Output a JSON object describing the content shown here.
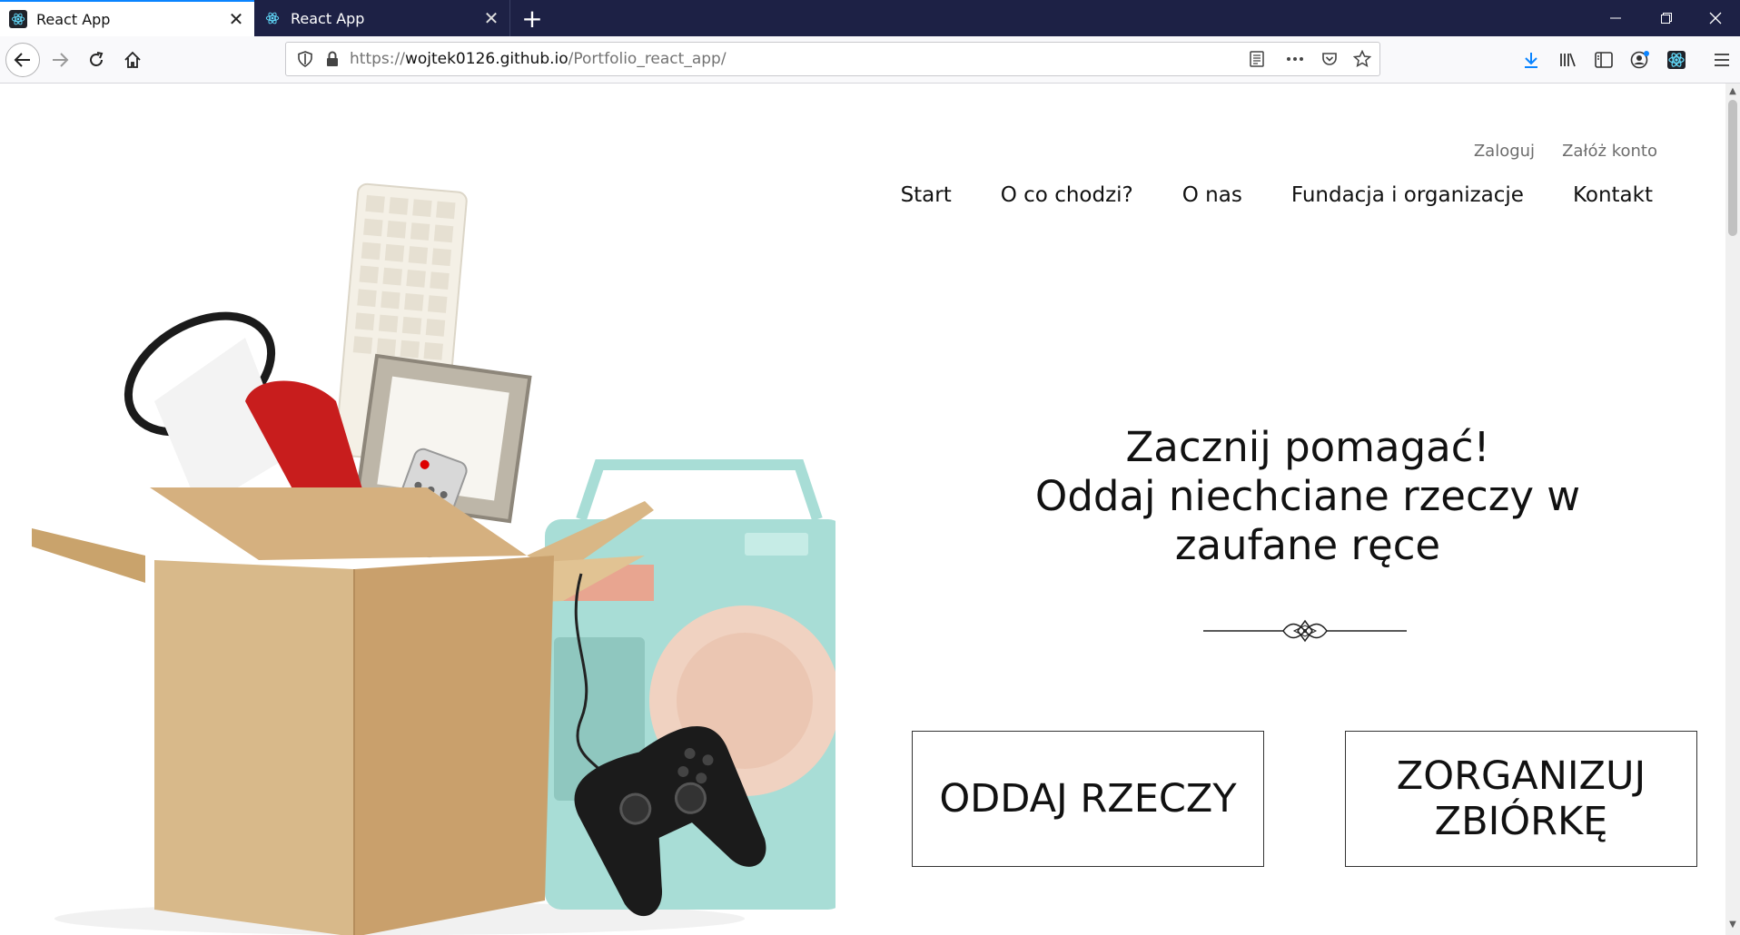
{
  "browser": {
    "tabs": [
      {
        "title": "React App",
        "active": true
      },
      {
        "title": "React App",
        "active": false
      }
    ],
    "url": {
      "scheme": "https://",
      "host": "wojtek0126.github.io",
      "path": "/Portfolio_react_app/"
    },
    "accent_color": "#0a84ff",
    "tabbar_color": "#1d2145"
  },
  "header": {
    "auth": {
      "login": "Zaloguj",
      "register": "Załóż konto"
    },
    "nav": [
      {
        "label": "Start"
      },
      {
        "label": "O co chodzi?"
      },
      {
        "label": "O nas"
      },
      {
        "label": "Fundacja i organizacje"
      },
      {
        "label": "Kontakt"
      }
    ]
  },
  "hero": {
    "headline_lines": [
      "Zacznij pomagać!",
      "Oddaj niechciane rzeczy w",
      "zaufane ręce"
    ],
    "buttons": {
      "give": "ODDAJ RZECZY",
      "organize_line1": "ZORGANIZUJ",
      "organize_line2": "ZBIÓRKĘ"
    }
  }
}
